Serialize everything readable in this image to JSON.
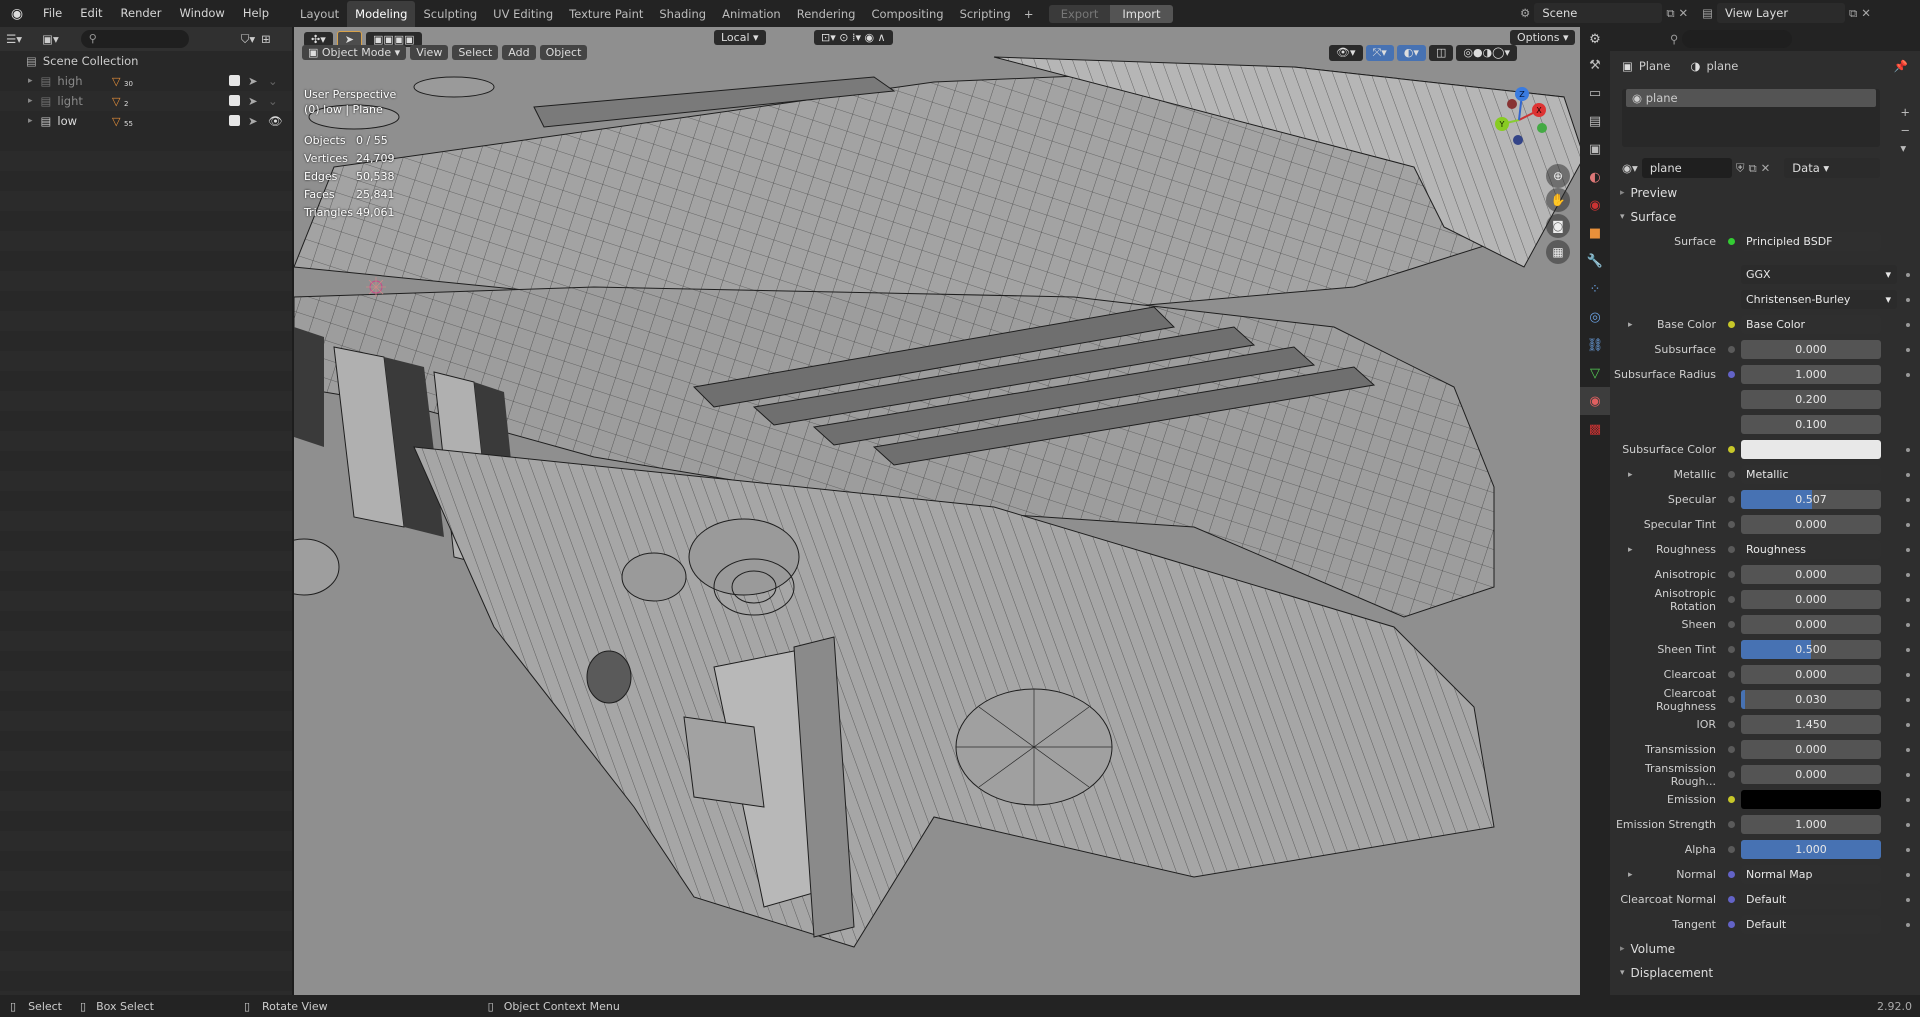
{
  "menu": [
    "File",
    "Edit",
    "Render",
    "Window",
    "Help"
  ],
  "workspaces": [
    "Layout",
    "Modeling",
    "Sculpting",
    "UV Editing",
    "Texture Paint",
    "Shading",
    "Animation",
    "Rendering",
    "Compositing",
    "Scripting"
  ],
  "export_label": "Export",
  "import_label": "Import",
  "scene_name": "Scene",
  "view_layer": "View Layer",
  "outliner": {
    "root": "Scene Collection",
    "items": [
      {
        "name": "high",
        "count": "30"
      },
      {
        "name": "light",
        "count": "2"
      },
      {
        "name": "low",
        "count": "55"
      }
    ]
  },
  "viewport": {
    "mode": "Object Mode",
    "menus": [
      "View",
      "Select",
      "Add",
      "Object"
    ],
    "transform": "Local",
    "options": "Options",
    "title": "User Perspective",
    "subtitle": "(0) low | Plane",
    "stats": [
      {
        "k": "Objects",
        "v": "0 / 55"
      },
      {
        "k": "Vertices",
        "v": "24,709"
      },
      {
        "k": "Edges",
        "v": "50,538"
      },
      {
        "k": "Faces",
        "v": "25,841"
      },
      {
        "k": "Triangles",
        "v": "49,061"
      }
    ],
    "axes": {
      "x": "X",
      "y": "Y",
      "z": "Z"
    }
  },
  "properties": {
    "object": "Plane",
    "material": "plane",
    "slot": "plane",
    "mat_field": "plane",
    "link": "Data",
    "preview": "Preview",
    "surface_panel": "Surface",
    "surface_label": "Surface",
    "shader": "Principled BSDF",
    "distribution": "GGX",
    "subsurface_method": "Christensen-Burley",
    "rows": [
      {
        "label": "Base Color",
        "value": "Base Color",
        "kind": "link",
        "expand": true,
        "sock": "#c7c729"
      },
      {
        "label": "Subsurface",
        "value": "0.000",
        "kind": "num",
        "fill": 0
      },
      {
        "label": "Subsurface Radius",
        "value": "1.000",
        "kind": "num",
        "fill": 0,
        "sock": "#6363c7"
      },
      {
        "label": "",
        "value": "0.200",
        "kind": "num",
        "fill": 0
      },
      {
        "label": "",
        "value": "0.100",
        "kind": "num",
        "fill": 0
      },
      {
        "label": "Subsurface Color",
        "value": "",
        "kind": "color",
        "color": "#e8e8e8",
        "sock": "#c7c729"
      },
      {
        "label": "Metallic",
        "value": "Metallic",
        "kind": "link",
        "expand": true
      },
      {
        "label": "Specular",
        "value": "0.507",
        "kind": "num",
        "fill": 0.507
      },
      {
        "label": "Specular Tint",
        "value": "0.000",
        "kind": "num",
        "fill": 0
      },
      {
        "label": "Roughness",
        "value": "Roughness",
        "kind": "link",
        "expand": true
      },
      {
        "label": "Anisotropic",
        "value": "0.000",
        "kind": "num",
        "fill": 0
      },
      {
        "label": "Anisotropic Rotation",
        "value": "0.000",
        "kind": "num",
        "fill": 0
      },
      {
        "label": "Sheen",
        "value": "0.000",
        "kind": "num",
        "fill": 0
      },
      {
        "label": "Sheen Tint",
        "value": "0.500",
        "kind": "num",
        "fill": 0.5
      },
      {
        "label": "Clearcoat",
        "value": "0.000",
        "kind": "num",
        "fill": 0
      },
      {
        "label": "Clearcoat Roughness",
        "value": "0.030",
        "kind": "num",
        "fill": 0.03
      },
      {
        "label": "IOR",
        "value": "1.450",
        "kind": "num",
        "fill": 0
      },
      {
        "label": "Transmission",
        "value": "0.000",
        "kind": "num",
        "fill": 0
      },
      {
        "label": "Transmission Rough...",
        "value": "0.000",
        "kind": "num",
        "fill": 0
      },
      {
        "label": "Emission",
        "value": "",
        "kind": "color",
        "color": "#000000",
        "sock": "#c7c729"
      },
      {
        "label": "Emission Strength",
        "value": "1.000",
        "kind": "num",
        "fill": 0
      },
      {
        "label": "Alpha",
        "value": "1.000",
        "kind": "num",
        "fill": 1
      },
      {
        "label": "Normal",
        "value": "Normal Map",
        "kind": "link",
        "expand": true,
        "sock": "#6363c7"
      },
      {
        "label": "Clearcoat Normal",
        "value": "Default",
        "kind": "link",
        "sock": "#6363c7"
      },
      {
        "label": "Tangent",
        "value": "Default",
        "kind": "link",
        "sock": "#6363c7"
      }
    ],
    "volume": "Volume",
    "displacement": "Displacement"
  },
  "status": {
    "select": "Select",
    "box_select": "Box Select",
    "rotate": "Rotate View",
    "context": "Object Context Menu",
    "version": "2.92.0"
  }
}
